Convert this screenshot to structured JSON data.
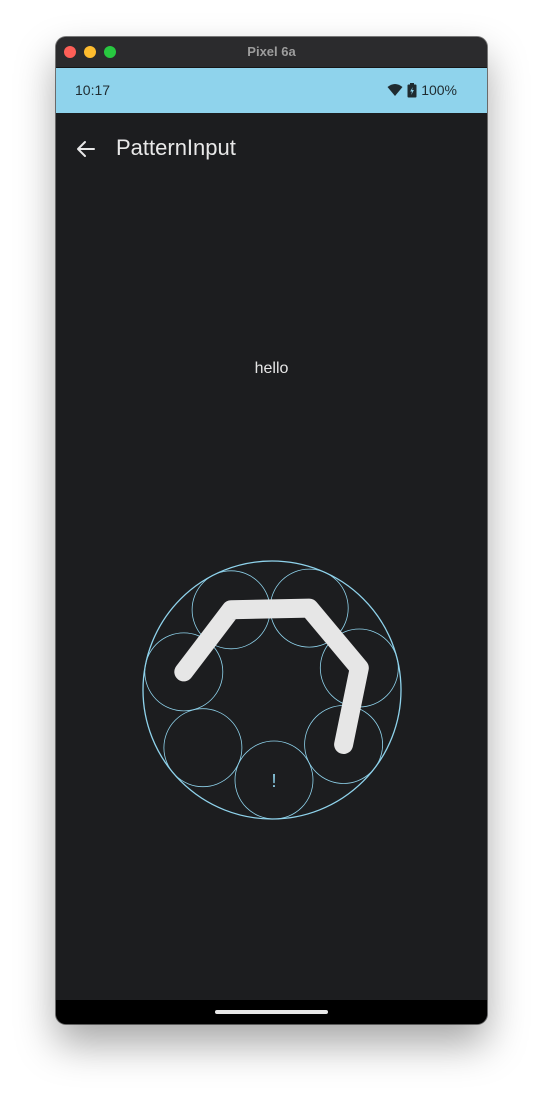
{
  "window": {
    "title": "Pixel 6a"
  },
  "status_bar": {
    "time": "10:17",
    "battery": "100%",
    "icons": [
      "wifi-icon",
      "battery-icon"
    ]
  },
  "app_bar": {
    "back_icon": "arrow-left-icon",
    "title": "PatternInput"
  },
  "content": {
    "message": "hello"
  },
  "pattern_input": {
    "nodes": [
      {
        "index": 0,
        "label": ""
      },
      {
        "index": 1,
        "label": ""
      },
      {
        "index": 2,
        "label": ""
      },
      {
        "index": 3,
        "label": "!"
      },
      {
        "index": 4,
        "label": "!"
      },
      {
        "index": 5,
        "label": ""
      },
      {
        "index": 6,
        "label": ""
      }
    ],
    "path_order": [
      6,
      0,
      1,
      2,
      3
    ],
    "colors": {
      "ring": "#8fd3ec",
      "path": "#e6e6e6"
    }
  },
  "colors": {
    "background": "#1c1d1f",
    "status_bar": "#8fd3ec",
    "nav_bar": "#000000"
  }
}
